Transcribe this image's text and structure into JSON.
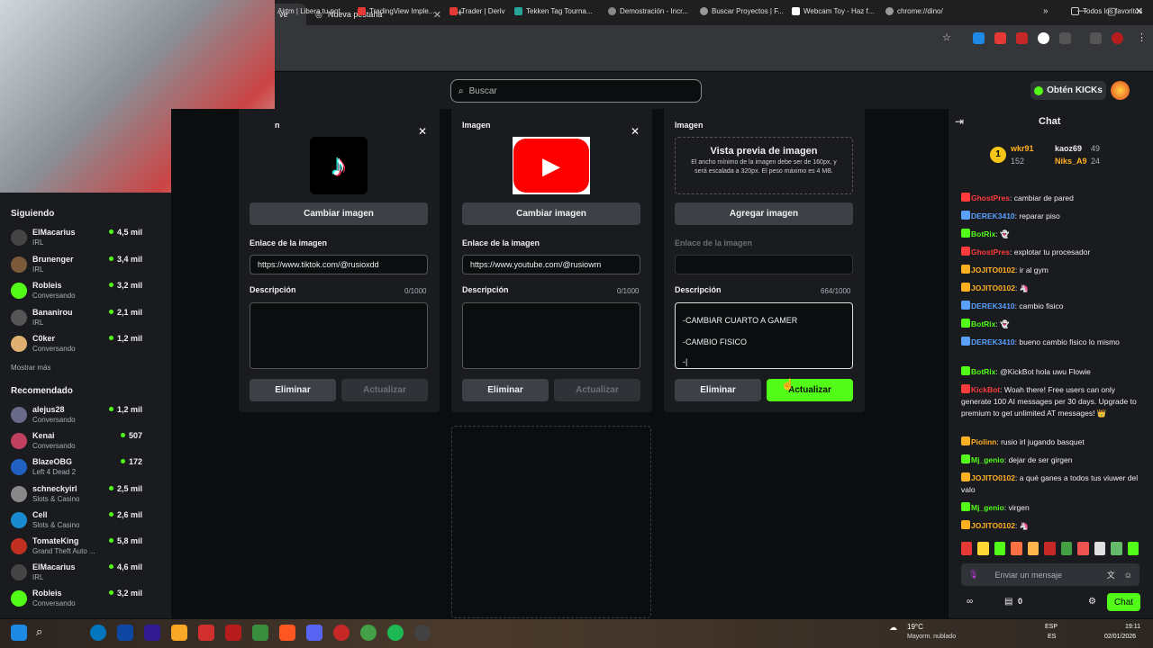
{
  "browser": {
    "tabs": [
      {
        "label": "ve"
      },
      {
        "label": "Nueva pestaña"
      }
    ],
    "new_tab": "+",
    "bookmarks": [
      "Airtm | Libera tu pot...",
      "TradingView Imple...",
      "Trader | Deriv",
      "Tekken Tag Tourna...",
      "Demostración - Incr...",
      "Buscar Proyectos | F...",
      "Webcam Toy - Haz f...",
      "chrome://dino/"
    ],
    "all_bookmarks": "Todos los favoritos"
  },
  "header": {
    "search_placeholder": "Buscar",
    "get_kicks": "Obtén KICKs"
  },
  "sidebar": {
    "following_title": "Siguiendo",
    "following": [
      {
        "name": "ElMacarius",
        "cat": "IRL",
        "viewers": "4,5 mil",
        "color": "#444"
      },
      {
        "name": "Brunenger",
        "cat": "IRL",
        "viewers": "3,4 mil",
        "color": "#7a5a3a"
      },
      {
        "name": "Robleis",
        "cat": "Conversando",
        "viewers": "3,2 mil",
        "color": "#53fc18"
      },
      {
        "name": "Bananirou",
        "cat": "IRL",
        "viewers": "2,1 mil",
        "color": "#555"
      },
      {
        "name": "C0ker",
        "cat": "Conversando",
        "viewers": "1,2 mil",
        "color": "#e0b070"
      }
    ],
    "show_more": "Mostrar más",
    "recommended_title": "Recomendado",
    "recommended": [
      {
        "name": "alejus28",
        "cat": "Conversando",
        "viewers": "1,2 mil",
        "color": "#6a6a8a"
      },
      {
        "name": "Kenai",
        "cat": "Conversando",
        "viewers": "507",
        "color": "#c04060"
      },
      {
        "name": "BlazeOBG",
        "cat": "Left 4 Dead 2",
        "viewers": "172",
        "color": "#2060c0"
      },
      {
        "name": "schneckyirl",
        "cat": "Slots & Casino",
        "viewers": "2,5 mil",
        "color": "#888"
      },
      {
        "name": "Cell",
        "cat": "Slots & Casino",
        "viewers": "2,6 mil",
        "color": "#1a8ad0"
      },
      {
        "name": "TomateKing",
        "cat": "Grand Theft Auto ...",
        "viewers": "5,8 mil",
        "color": "#c03020"
      },
      {
        "name": "ElMacarius",
        "cat": "IRL",
        "viewers": "4,6 mil",
        "color": "#444"
      },
      {
        "name": "Robleis",
        "cat": "Conversando",
        "viewers": "3,2 mil",
        "color": "#53fc18"
      }
    ]
  },
  "panels": [
    {
      "label": "n",
      "change": "Cambiar imagen",
      "link_label": "Enlace de la imagen",
      "link": "https://www.tiktok.com/@rusioxdd",
      "desc_label": "Descripción",
      "count": "0/1000",
      "delete": "Eliminar",
      "update": "Actualizar"
    },
    {
      "label": "Imagen",
      "change": "Cambiar imagen",
      "link_label": "Enlace de la imagen",
      "link": "https://www.youtube.com/@rusiowm",
      "desc_label": "Descripción",
      "count": "0/1000",
      "delete": "Eliminar",
      "update": "Actualizar"
    },
    {
      "label": "Imagen",
      "preview_title": "Vista previa de imagen",
      "preview_text": "El ancho mínimo de la imagen debe ser de 160px, y será escalada a 320px. El peso máximo es 4 MB.",
      "change": "Agregar imagen",
      "link_label": "Enlace de la imagen",
      "link": "",
      "desc_label": "Descripción",
      "count": "664/1000",
      "desc_lines": [
        "-CAMBIAR CUARTO A GAMER",
        "-CAMBIO FISICO",
        "-|"
      ],
      "delete": "Eliminar",
      "update": "Actualizar"
    }
  ],
  "chat": {
    "title": "Chat",
    "top": [
      {
        "name": "wkr91",
        "score": "152"
      },
      {
        "name": "kaoz69",
        "score": "49"
      },
      {
        "name": "Niks_A9",
        "score": "24"
      }
    ],
    "messages": [
      {
        "user": "GhostPres",
        "color": "#ff3b3b",
        "text": "cambiar de pared"
      },
      {
        "user": "DEREK3410",
        "color": "#5aa0ff",
        "text": "reparar piso"
      },
      {
        "user": "BotRix",
        "color": "#53fc18",
        "text": "👻"
      },
      {
        "user": "GhostPres",
        "color": "#ff3b3b",
        "text": "explotar tu procesador"
      },
      {
        "user": "JOJITO0102",
        "color": "#ffb020",
        "text": "ir al gym"
      },
      {
        "user": "JOJITO0102",
        "color": "#ffb020",
        "text": "🦄"
      },
      {
        "user": "DEREK3410",
        "color": "#5aa0ff",
        "text": "cambio fisico"
      },
      {
        "user": "BotRix",
        "color": "#53fc18",
        "text": "👻"
      },
      {
        "user": "DEREK3410",
        "color": "#5aa0ff",
        "text": "bueno cambio fisico lo mismo"
      },
      {
        "user": "BotRix",
        "color": "#53fc18",
        "text": "@KickBot hola uwu Flowie"
      },
      {
        "user": "KickBot",
        "color": "#ff3b3b",
        "text": "Woah there! Free users can only generate 100 AI messages per 30 days. Upgrade to premium to get unlimited AT messages! 👑"
      },
      {
        "user": "Piolinn",
        "color": "#ffb020",
        "text": "rusio irl jugando basquet"
      },
      {
        "user": "Mj_genio",
        "color": "#53fc18",
        "text": "dejar de ser girgen"
      },
      {
        "user": "JOJITO0102",
        "color": "#ffb020",
        "text": "a qué ganes a todos tus viuwer del valo"
      },
      {
        "user": "Mj_genio",
        "color": "#53fc18",
        "text": "virgen"
      },
      {
        "user": "JOJITO0102",
        "color": "#ffb020",
        "text": "🦄"
      }
    ],
    "placeholder": "Enviar un mensaje",
    "count": "0",
    "send": "Chat"
  },
  "taskbar": {
    "weather": "19°C",
    "weather_desc": "Mayorm. nublado",
    "lang1": "ESP",
    "lang2": "ES",
    "time": "19:11",
    "date": "02/01/2026"
  }
}
